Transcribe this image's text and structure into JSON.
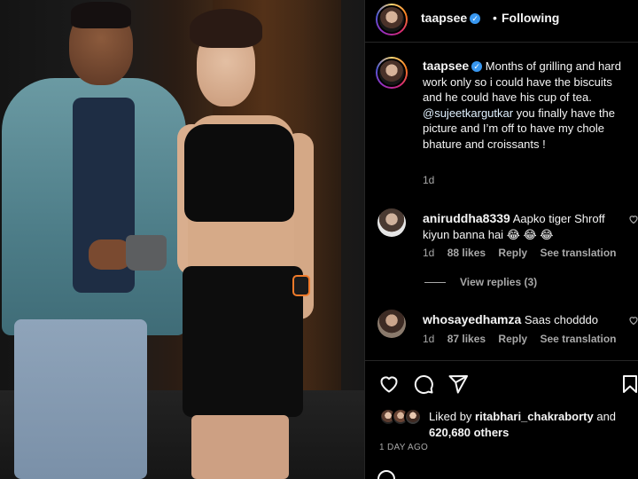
{
  "post": {
    "username": "taapsee",
    "follow_state": "Following",
    "separator": "•"
  },
  "caption": {
    "username": "taapsee",
    "text_part1": "Months of grilling and hard work only so i could have the biscuits and he could have his cup of tea.",
    "mention": "@sujeetkargutkar",
    "text_part2": " you finally have the picture and I’m off to have my chole bhature and croissants !",
    "time": "1d"
  },
  "comments": [
    {
      "username": "aniruddha8339",
      "text": "Aapko tiger Shroff kiyun banna hai",
      "emoji": "😂 😂 😂",
      "time": "1d",
      "likes": "88 likes",
      "reply": "Reply",
      "translate": "See translation"
    },
    {
      "username": "whosayedhamza",
      "text": "Saas chodddo",
      "time": "1d",
      "likes": "87 likes",
      "reply": "Reply",
      "translate": "See translation"
    }
  ],
  "view_replies": "View replies (3)",
  "likes": {
    "prefix": "Liked by",
    "liker": "ritabhari_chakraborty",
    "joiner": "and",
    "others": "620,680 others"
  },
  "date_label": "1 DAY AGO",
  "icons": {
    "like": "heart-icon",
    "comment": "comment-icon",
    "share": "share-icon",
    "save": "bookmark-icon",
    "verified": "verified-badge-icon"
  },
  "colors": {
    "background": "#000000",
    "text": "#f5f5f5",
    "muted": "#a8a8a8",
    "verified": "#3897f0",
    "divider": "#262626"
  }
}
